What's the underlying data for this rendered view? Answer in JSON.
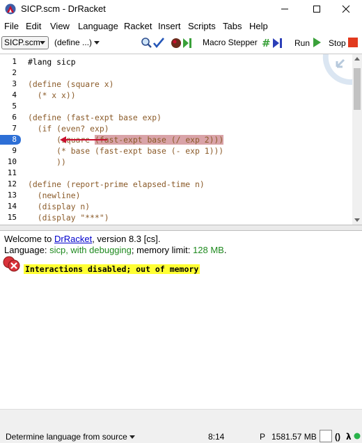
{
  "window": {
    "title": "SICP.scm - DrRacket"
  },
  "menu": [
    "File",
    "Edit",
    "View",
    "Language",
    "Racket",
    "Insert",
    "Scripts",
    "Tabs",
    "Help"
  ],
  "toolbar": {
    "file_name": "SICP.scm",
    "define_menu": "(define ...)",
    "macro_stepper": "Macro Stepper",
    "run": "Run",
    "stop": "Stop"
  },
  "editor": {
    "lines": [
      {
        "n": "1",
        "text": "#lang sicp"
      },
      {
        "n": "2",
        "text": ""
      },
      {
        "n": "3",
        "text": "(define (square x)"
      },
      {
        "n": "4",
        "text": "  (* x x))"
      },
      {
        "n": "5",
        "text": ""
      },
      {
        "n": "6",
        "text": "(define (fast-expt base exp)"
      },
      {
        "n": "7",
        "text": "  (if (even? exp)"
      },
      {
        "n": "8",
        "text": "      (square (fast-expt base (/ exp 2)))"
      },
      {
        "n": "9",
        "text": "      (* base (fast-expt base (- exp 1)))"
      },
      {
        "n": "10",
        "text": "      ))"
      },
      {
        "n": "11",
        "text": ""
      },
      {
        "n": "12",
        "text": "(define (report-prime elapsed-time n)"
      },
      {
        "n": "13",
        "text": "  (newline)"
      },
      {
        "n": "14",
        "text": "  (display n)"
      },
      {
        "n": "15",
        "text": "  (display \"***\")"
      }
    ],
    "current_line": "8"
  },
  "interactions": {
    "welcome_prefix": "Welcome to ",
    "welcome_link": "DrRacket",
    "welcome_suffix": ", version 8.3 [cs].",
    "lang_prefix": "Language: ",
    "lang_value": "sicp, with debugging",
    "lang_mid": "; memory limit: ",
    "lang_limit": "128 MB",
    "lang_end": ".",
    "error": "Interactions disabled; out of memory"
  },
  "status": {
    "language": "Determine language from source",
    "position": "8:14",
    "p": "P",
    "memory": "1581.57 MB",
    "parens": "()"
  },
  "colors": {
    "highlight": "#d9a3a8",
    "keyword_brown": "#8a5a28",
    "error_yellow": "#ffff33",
    "link": "#0000cc"
  }
}
